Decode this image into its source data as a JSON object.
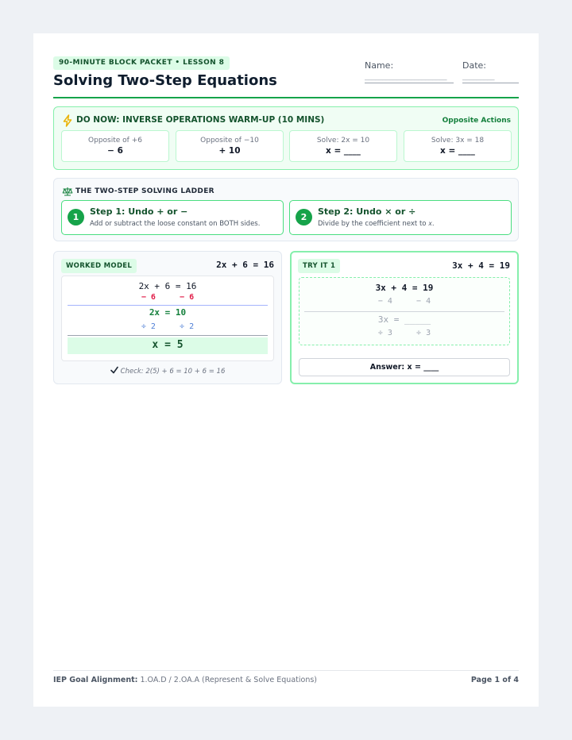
{
  "header": {
    "tag": "90-MINUTE BLOCK PACKET • LESSON 8",
    "title": "Solving Two-Step Equations",
    "name_label": "Name:",
    "date_label": "Date:",
    "name_blank": "_______________________",
    "date_blank": "_________"
  },
  "do_now": {
    "title": "DO NOW: INVERSE OPERATIONS WARM-UP (10 MINS)",
    "right_label": "Opposite Actions",
    "icon": "lightning-icon",
    "cells": [
      {
        "label": "Opposite of +6",
        "value": "− 6"
      },
      {
        "label": "Opposite of −10",
        "value": "+ 10"
      },
      {
        "label": "Solve: 2x = 10",
        "value": "x = ____"
      },
      {
        "label": "Solve: 3x = 18",
        "value": "x = ____"
      }
    ]
  },
  "ladder": {
    "title": "THE TWO-STEP SOLVING LADDER",
    "icon": "balance-scale-icon",
    "steps": [
      {
        "num": "1",
        "title": "Step 1: Undo + or −",
        "desc": "Add or subtract the loose constant on BOTH sides."
      },
      {
        "num": "2",
        "title": "Step 2: Undo × or ÷",
        "desc": "Divide by the coefficient next to 𝑥."
      }
    ]
  },
  "worked": {
    "badge": "WORKED MODEL",
    "equation": "2x + 6 = 16",
    "lines": {
      "eq": "2x + 6 = 16",
      "sub": "− 6     − 6",
      "mid": "2x = 10",
      "div": "÷ 2     ÷ 2",
      "answer": "x = 5"
    },
    "check": "Check: 2(5) + 6 = 10 + 6 = 16",
    "check_icon": "checkmark-icon"
  },
  "try_it": {
    "badge": "TRY IT 1",
    "equation": "3x + 4 = 19",
    "lines": {
      "eq": "3x + 4 = 19",
      "sub": "− 4     − 4",
      "mid": "3x = _____",
      "div": "÷ 3     ÷ 3"
    },
    "answer": "Answer: x = ____"
  },
  "footer": {
    "label": "IEP Goal Alignment:",
    "text": " 1.OA.D / 2.OA.A (Represent & Solve Equations)",
    "page": "Page 1 of 4"
  },
  "colors": {
    "accent": "#16a34a",
    "accent_light": "#dcfce7",
    "subtract_red": "#e11d48",
    "divide_blue": "#4f7fd6"
  }
}
